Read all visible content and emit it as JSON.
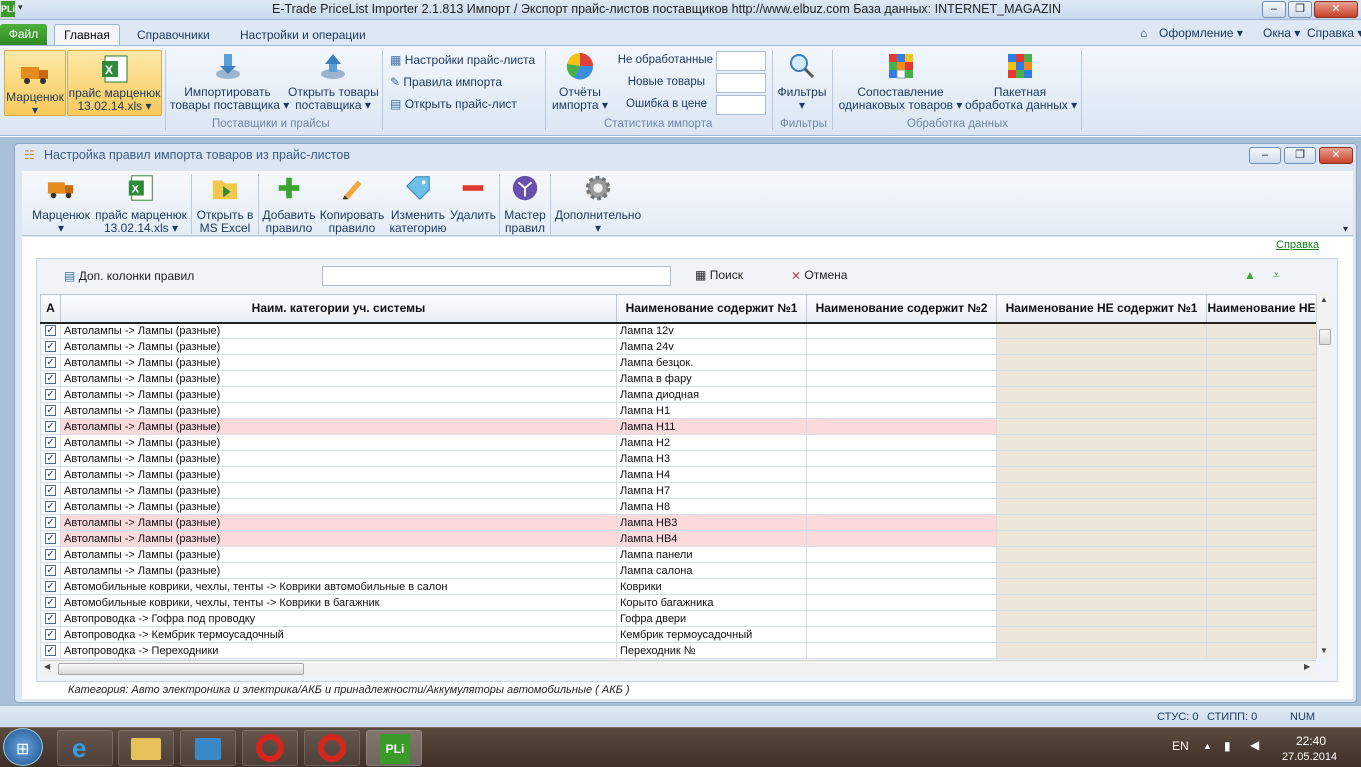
{
  "window": {
    "title": "E-Trade PriceList Importer 2.1.813     Импорт / Экспорт прайс-листов поставщиков     http://www.elbuz.com     База данных: INTERNET_MAGAZIN",
    "app_icon": "PLi"
  },
  "ribbon_tabs": {
    "file": "Файл",
    "home": "Главная",
    "refs": "Справочники",
    "settings": "Настройки и операции"
  },
  "ribbon_right": {
    "design": "Оформление",
    "windows": "Окна",
    "help": "Справка"
  },
  "ribbon": {
    "supplier_line1": "Марценюк",
    "pricelist_line1": "прайс марценюк",
    "pricelist_line2": "13.02.14.xls",
    "import_line1": "Импортировать",
    "import_line2": "товары поставщика",
    "open_line1": "Открыть товары",
    "open_line2": "поставщика",
    "group1": "Поставщики и прайсы",
    "pl_settings": "Настройки прайс-листа",
    "import_rules": "Правила импорта",
    "open_pl": "Открыть прайс-лист",
    "reports_line1": "Отчёты",
    "reports_line2": "импорта",
    "not_processed": "Не обработанные",
    "new_goods": "Новые товары",
    "price_error": "Ошибка в цене",
    "group2": "Статистика импорта",
    "filters": "Фильтры",
    "group3": "Фильтры",
    "compare_line1": "Сопоставление",
    "compare_line2": "одинаковых товаров",
    "batch_line1": "Пакетная",
    "batch_line2": "обработка данных",
    "group4": "Обработка данных"
  },
  "child_window": {
    "title": "Настройка правил импорта товаров из прайс-листов",
    "help_link": "Справка"
  },
  "toolbar": {
    "supplier": "Марценюк",
    "pricelist_line1": "прайс марценюк",
    "pricelist_line2": "13.02.14.xls",
    "excel_line1": "Открыть в",
    "excel_line2": "MS Excel",
    "add_line1": "Добавить",
    "add_line2": "правило",
    "copy_line1": "Копировать",
    "copy_line2": "правило",
    "change_line1": "Изменить",
    "change_line2": "категорию",
    "delete": "Удалить",
    "wizard_line1": "Мастер",
    "wizard_line2": "правил",
    "more": "Дополнительно"
  },
  "search": {
    "extra_columns": "Доп. колонки правил",
    "value": "",
    "search_btn": "Поиск",
    "cancel_btn": "Отмена"
  },
  "grid": {
    "columns": [
      "A",
      "Наим. категории уч. системы",
      "Наименование содержит №1",
      "Наименование содержит №2",
      "Наименование НЕ содержит №1",
      "Наименование НЕ"
    ],
    "rows": [
      {
        "cat": "Автолампы -> Лампы (разные)",
        "c1": "Лампа 12v",
        "pink": false
      },
      {
        "cat": "Автолампы -> Лампы (разные)",
        "c1": "Лампа 24v",
        "pink": false
      },
      {
        "cat": "Автолампы -> Лампы (разные)",
        "c1": "Лампа безцок.",
        "pink": false
      },
      {
        "cat": "Автолампы -> Лампы (разные)",
        "c1": "Лампа в фару",
        "pink": false
      },
      {
        "cat": "Автолампы -> Лампы (разные)",
        "c1": "Лампа диодная",
        "pink": false
      },
      {
        "cat": "Автолампы -> Лампы (разные)",
        "c1": "Лампа H1",
        "pink": false
      },
      {
        "cat": "Автолампы -> Лампы (разные)",
        "c1": "Лампа H11",
        "pink": true
      },
      {
        "cat": "Автолампы -> Лампы (разные)",
        "c1": "Лампа H2",
        "pink": false
      },
      {
        "cat": "Автолампы -> Лампы (разные)",
        "c1": "Лампа H3",
        "pink": false
      },
      {
        "cat": "Автолампы -> Лампы (разные)",
        "c1": "Лампа H4",
        "pink": false
      },
      {
        "cat": "Автолампы -> Лампы (разные)",
        "c1": "Лампа H7",
        "pink": false
      },
      {
        "cat": "Автолампы -> Лампы (разные)",
        "c1": "Лампа H8",
        "pink": false
      },
      {
        "cat": "Автолампы -> Лампы (разные)",
        "c1": "Лампа HB3",
        "pink": true
      },
      {
        "cat": "Автолампы -> Лампы (разные)",
        "c1": "Лампа HB4",
        "pink": true
      },
      {
        "cat": "Автолампы -> Лампы (разные)",
        "c1": "Лампа панели",
        "pink": false
      },
      {
        "cat": "Автолампы -> Лампы (разные)",
        "c1": "Лампа салона",
        "pink": false
      },
      {
        "cat": "Автомобильные коврики, чехлы, тенты -> Коврики автомобильные в салон",
        "c1": "Коврики",
        "pink": false
      },
      {
        "cat": "Автомобильные коврики, чехлы, тенты -> Коврики в багажник",
        "c1": "Корыто багажника",
        "pink": false
      },
      {
        "cat": "Автопроводка -> Гофра под проводку",
        "c1": "Гофра двери",
        "pink": false
      },
      {
        "cat": "Автопроводка -> Кембрик термоусадочный",
        "c1": "Кембрик термоусадочный",
        "pink": false
      },
      {
        "cat": "Автопроводка -> Переходники",
        "c1": "Переходник №",
        "pink": false
      }
    ]
  },
  "category_footer": "Категория: Авто электроника и электрика/АКБ и принадлежности/Аккумуляторы автомобильные ( АКБ )",
  "statusbar": {
    "stus": "СТУС: 0",
    "stipp": "СТИПП: 0",
    "num": "NUM"
  },
  "taskbar": {
    "lang": "EN",
    "time": "22:40",
    "date": "27.05.2014"
  },
  "colors": {
    "accent": "#2f8a23",
    "pink_row": "#fadadb",
    "beige_col": "#ece6d9"
  }
}
